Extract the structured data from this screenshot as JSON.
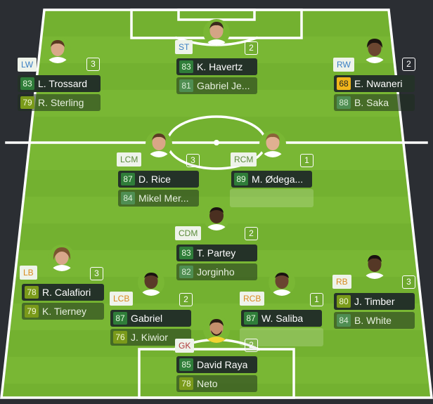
{
  "colors": {
    "pitch_light": "#79b734",
    "pitch_dark": "#6aa92c",
    "background": "#2b2e33"
  },
  "lineup": {
    "lw": {
      "pos": "LW",
      "count": "3",
      "main": {
        "rating": "83",
        "name": "L. Trossard"
      },
      "sub": {
        "rating": "79",
        "name": "R. Sterling"
      }
    },
    "st": {
      "pos": "ST",
      "count": "2",
      "main": {
        "rating": "83",
        "name": "K. Havertz"
      },
      "sub": {
        "rating": "81",
        "name": "Gabriel Je..."
      }
    },
    "rw": {
      "pos": "RW",
      "count": "2",
      "main": {
        "rating": "68",
        "name": "E. Nwaneri"
      },
      "sub": {
        "rating": "88",
        "name": "B. Saka"
      }
    },
    "lcm": {
      "pos": "LCM",
      "count": "3",
      "main": {
        "rating": "87",
        "name": "D. Rice"
      },
      "sub": {
        "rating": "84",
        "name": "Mikel Mer..."
      }
    },
    "rcm": {
      "pos": "RCM",
      "count": "1",
      "main": {
        "rating": "89",
        "name": "M. Ødega..."
      }
    },
    "cdm": {
      "pos": "CDM",
      "count": "2",
      "main": {
        "rating": "83",
        "name": "T. Partey"
      },
      "sub": {
        "rating": "82",
        "name": "Jorginho"
      }
    },
    "lb": {
      "pos": "LB",
      "count": "3",
      "main": {
        "rating": "78",
        "name": "R. Calafiori"
      },
      "sub": {
        "rating": "79",
        "name": "K. Tierney"
      }
    },
    "lcb": {
      "pos": "LCB",
      "count": "2",
      "main": {
        "rating": "87",
        "name": "Gabriel"
      },
      "sub": {
        "rating": "76",
        "name": "J. Kiwior"
      }
    },
    "rcb": {
      "pos": "RCB",
      "count": "1",
      "main": {
        "rating": "87",
        "name": "W. Saliba"
      }
    },
    "rb": {
      "pos": "RB",
      "count": "3",
      "main": {
        "rating": "80",
        "name": "J. Timber"
      },
      "sub": {
        "rating": "84",
        "name": "B. White"
      }
    },
    "gk": {
      "pos": "GK",
      "count": "2",
      "main": {
        "rating": "85",
        "name": "David Raya"
      },
      "sub": {
        "rating": "78",
        "name": "Neto"
      }
    }
  }
}
